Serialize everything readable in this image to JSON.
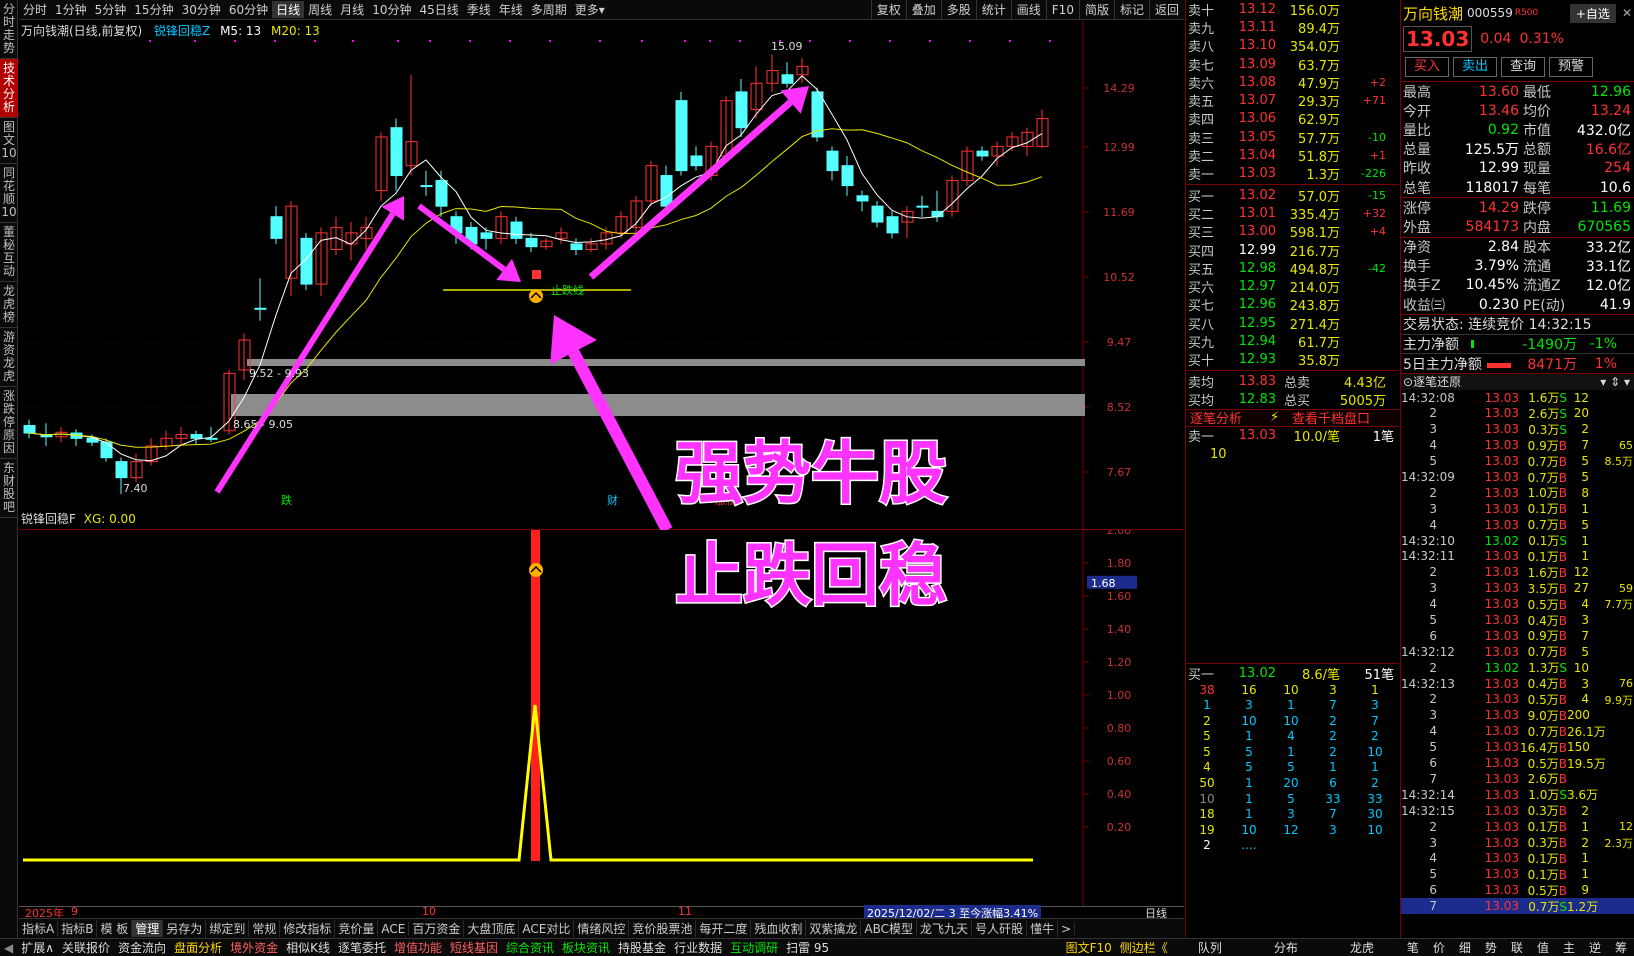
{
  "sidebar": [
    "分时走势",
    "技术分析",
    "图文10",
    "同花顺10",
    "董秘互动",
    "龙虎榜",
    "游资龙虎",
    "涨跌停原因",
    "东财股吧"
  ],
  "topbar": {
    "tabs": [
      "分时",
      "1分钟",
      "5分钟",
      "15分钟",
      "30分钟",
      "60分钟",
      "日线",
      "周线",
      "月线",
      "10分钟",
      "45日线",
      "季线",
      "年线",
      "多周期",
      "更多▾"
    ],
    "active": "日线",
    "right": [
      "复权",
      "叠加",
      "多股",
      "统计",
      "画线",
      "F10",
      "简版",
      "标记",
      "返回"
    ]
  },
  "chart": {
    "title": "万向钱潮(日线,前复权)",
    "indicator": "锐锋回稳Z",
    "m5": "M5: 13",
    "m20": "M20: 13",
    "yticks": [
      "14.29",
      "12.99",
      "11.69",
      "10.52",
      "9.47",
      "8.52",
      "7.67"
    ],
    "high_label": "15.09",
    "low_label": "7.40",
    "zone1": "9.52 - 9.93",
    "zone2": "8.65 - 9.05",
    "stopline": "止跌线",
    "events": [
      "跌",
      "财",
      "涨榜"
    ],
    "overlay1": "强势牛股",
    "overlay2": "止跌回稳",
    "sub_title": "锐锋回稳F",
    "sub_xg": "XG: 0.00",
    "sub_yticks": [
      "2.00",
      "1.80",
      "1.60",
      "1.40",
      "1.20",
      "1.00",
      "0.80",
      "0.60",
      "0.40",
      "0.20"
    ],
    "sub_cursor": "1.68",
    "xlabels": [
      "2025年",
      "9",
      "10",
      "11"
    ],
    "info": "2025/12/02/二 3 至今涨幅3.41%",
    "period": "日线"
  },
  "chart_data": {
    "type": "candlestick",
    "title": "万向钱潮(日线,前复权)",
    "ylim": [
      7.4,
      15.09
    ],
    "high": 15.09,
    "low": 7.4
  },
  "bottombar": [
    "指标A",
    "指标B",
    "模 板",
    "管理",
    "另存为",
    "绑定到",
    "常规",
    "修改指标",
    "竞价量",
    "ACE",
    "百万资金",
    "大盘顶底",
    "ACE对比",
    "情绪风控",
    "竞价股票池",
    "每开二度",
    "残血收割",
    "双紫擒龙",
    "ABC模型",
    "龙飞九天",
    "号人矸股",
    "懂牛",
    ">"
  ],
  "bottom_active": "管理",
  "statusbar": [
    "扩展∧",
    "关联报价",
    "资金流向",
    "盘面分析",
    "境外资金",
    "相似K线",
    "逐笔委托",
    "增值功能",
    "短线基因",
    "综合资讯",
    "板块资讯",
    "持股基金",
    "行业数据",
    "互动调研",
    "扫雷 95"
  ],
  "status_right": [
    "图文F10",
    "侧边栏《",
    "队列",
    "分布",
    "龙虎"
  ],
  "asks": [
    [
      "卖十",
      "13.12",
      "156.0万",
      ""
    ],
    [
      "卖九",
      "13.11",
      "89.4万",
      ""
    ],
    [
      "卖八",
      "13.10",
      "354.0万",
      ""
    ],
    [
      "卖七",
      "13.09",
      "63.7万",
      ""
    ],
    [
      "卖六",
      "13.08",
      "47.9万",
      "+2"
    ],
    [
      "卖五",
      "13.07",
      "29.3万",
      "+71"
    ],
    [
      "卖四",
      "13.06",
      "62.9万",
      ""
    ],
    [
      "卖三",
      "13.05",
      "57.7万",
      "-10"
    ],
    [
      "卖二",
      "13.04",
      "51.8万",
      "+1"
    ],
    [
      "卖一",
      "13.03",
      "1.3万",
      "-226"
    ]
  ],
  "bids": [
    [
      "买一",
      "13.02",
      "57.0万",
      "-15"
    ],
    [
      "买二",
      "13.01",
      "335.4万",
      "+32"
    ],
    [
      "买三",
      "13.00",
      "598.1万",
      "+4"
    ],
    [
      "买四",
      "12.99",
      "216.7万",
      ""
    ],
    [
      "买五",
      "12.98",
      "494.8万",
      "-42"
    ],
    [
      "买六",
      "12.97",
      "214.0万",
      ""
    ],
    [
      "买七",
      "12.96",
      "243.8万",
      ""
    ],
    [
      "买八",
      "12.95",
      "271.4万",
      ""
    ],
    [
      "买九",
      "12.94",
      "61.7万",
      ""
    ],
    [
      "买十",
      "12.93",
      "35.8万",
      ""
    ]
  ],
  "avg": {
    "sell_avg_label": "卖均",
    "sell_avg": "13.83",
    "sell_total_label": "总卖",
    "sell_total": "4.43亿",
    "buy_avg_label": "买均",
    "buy_avg": "12.83",
    "buy_total_label": "总买",
    "buy_total": "5005万"
  },
  "tick_tabs": [
    "逐笔分析",
    "查看千档盘口"
  ],
  "sell1_line": {
    "label": "卖一",
    "price": "13.03",
    "per": "10.0/笔",
    "count": "1笔",
    "first": "10"
  },
  "buy1_line": {
    "label": "买一",
    "price": "13.02",
    "per": "8.6/笔",
    "count": "51笔"
  },
  "buy_grid": [
    [
      "38",
      "16",
      "10",
      "3",
      "1"
    ],
    [
      "1",
      "3",
      "1",
      "7",
      "3"
    ],
    [
      "2",
      "10",
      "10",
      "2",
      "7"
    ],
    [
      "5",
      "1",
      "4",
      "2",
      "2"
    ],
    [
      "5",
      "5",
      "1",
      "2",
      "10"
    ],
    [
      "4",
      "5",
      "5",
      "1",
      "1"
    ],
    [
      "50",
      "1",
      "20",
      "6",
      "2"
    ],
    [
      "10",
      "1",
      "5",
      "33",
      "33"
    ],
    [
      "18",
      "1",
      "3",
      "7",
      "30"
    ],
    [
      "19",
      "10",
      "12",
      "3",
      "10"
    ],
    [
      "2",
      "....",
      "",
      "",
      ""
    ]
  ],
  "stock": {
    "name": "万向钱潮",
    "code": "000559",
    "tag": "R500",
    "fav": "+自选",
    "price": "13.03",
    "chg": "0.04",
    "pct": "0.31%",
    "buttons": [
      "买入",
      "卖出",
      "查询",
      "预警"
    ]
  },
  "quote": [
    [
      "最高",
      "13.60",
      "最低",
      "12.96"
    ],
    [
      "今开",
      "13.46",
      "均价",
      "13.24"
    ],
    [
      "量比",
      "0.92",
      "市值",
      "432.0亿"
    ],
    [
      "总量",
      "125.5万",
      "总额",
      "16.6亿"
    ],
    [
      "昨收",
      "12.99",
      "现量",
      "254"
    ],
    [
      "总笔",
      "118017",
      "每笔",
      "10.6"
    ],
    [
      "涨停",
      "14.29",
      "跌停",
      "11.69"
    ],
    [
      "外盘",
      "584173",
      "内盘",
      "670565"
    ],
    [
      "净资",
      "2.84",
      "股本",
      "33.2亿"
    ],
    [
      "换手",
      "3.79%",
      "流通",
      "33.1亿"
    ],
    [
      "换手Z",
      "10.45%",
      "流通Z",
      "12.0亿"
    ],
    [
      "收益㈢",
      "0.230",
      "PE(动)",
      "41.9"
    ]
  ],
  "trade_state": "交易状态: 连续竞价 14:32:15",
  "flow": [
    [
      "主力净额",
      "-1490万",
      "-1%"
    ],
    [
      "5日主力净额",
      "8471万",
      "1%"
    ]
  ],
  "ticks_title": "逐笔还原",
  "ticks": [
    [
      "14:32:08",
      "13.03",
      "1.6万S",
      "12",
      ""
    ],
    [
      "2",
      "13.03",
      "2.6万S",
      "20",
      ""
    ],
    [
      "3",
      "13.03",
      "0.3万S",
      "2",
      ""
    ],
    [
      "4",
      "13.03",
      "0.9万B",
      "7",
      "65"
    ],
    [
      "5",
      "13.03",
      "0.7万B",
      "5",
      "8.5万"
    ],
    [
      "14:32:09",
      "13.03",
      "0.7万B",
      "5",
      ""
    ],
    [
      "2",
      "13.03",
      "1.0万B",
      "8",
      ""
    ],
    [
      "3",
      "13.03",
      "0.1万B",
      "1",
      ""
    ],
    [
      "4",
      "13.03",
      "0.7万B",
      "5",
      ""
    ],
    [
      "14:32:10",
      "13.02",
      "0.1万S",
      "1",
      ""
    ],
    [
      "14:32:11",
      "13.03",
      "0.1万B",
      "1",
      ""
    ],
    [
      "2",
      "13.03",
      "1.6万B",
      "12",
      ""
    ],
    [
      "3",
      "13.03",
      "3.5万B",
      "27",
      "59"
    ],
    [
      "4",
      "13.03",
      "0.5万B",
      "4",
      "7.7万"
    ],
    [
      "5",
      "13.03",
      "0.4万B",
      "3",
      ""
    ],
    [
      "6",
      "13.03",
      "0.9万B",
      "7",
      ""
    ],
    [
      "14:32:12",
      "13.03",
      "0.7万B",
      "5",
      ""
    ],
    [
      "2",
      "13.02",
      "1.3万S",
      "10",
      ""
    ],
    [
      "14:32:13",
      "13.03",
      "0.4万B",
      "3",
      "76"
    ],
    [
      "2",
      "13.03",
      "0.5万B",
      "4",
      "9.9万"
    ],
    [
      "3",
      "13.03",
      "9.0万B",
      "200",
      ""
    ],
    [
      "4",
      "13.03",
      "0.7万B",
      "26.1万",
      ""
    ],
    [
      "5",
      "13.03",
      "16.4万B",
      "150",
      ""
    ],
    [
      "6",
      "13.03",
      "0.5万B",
      "19.5万",
      ""
    ],
    [
      "7",
      "13.03",
      "2.6万B",
      "",
      ""
    ],
    [
      "14:32:14",
      "13.03",
      "1.0万S",
      "3.6万",
      ""
    ],
    [
      "14:32:15",
      "13.03",
      "0.3万B",
      "2",
      ""
    ],
    [
      "2",
      "13.03",
      "0.1万B",
      "1",
      "12"
    ],
    [
      "3",
      "13.03",
      "0.3万B",
      "2",
      "2.3万"
    ],
    [
      "4",
      "13.03",
      "0.1万B",
      "1",
      ""
    ],
    [
      "5",
      "13.03",
      "0.1万B",
      "1",
      ""
    ],
    [
      "6",
      "13.03",
      "0.5万B",
      "9",
      ""
    ],
    [
      "7",
      "13.03",
      "0.7万S",
      "1.2万",
      ""
    ]
  ],
  "right_bottom": [
    "笔",
    "价",
    "细",
    "势",
    "联",
    "值",
    "主",
    "逆",
    "筹"
  ]
}
